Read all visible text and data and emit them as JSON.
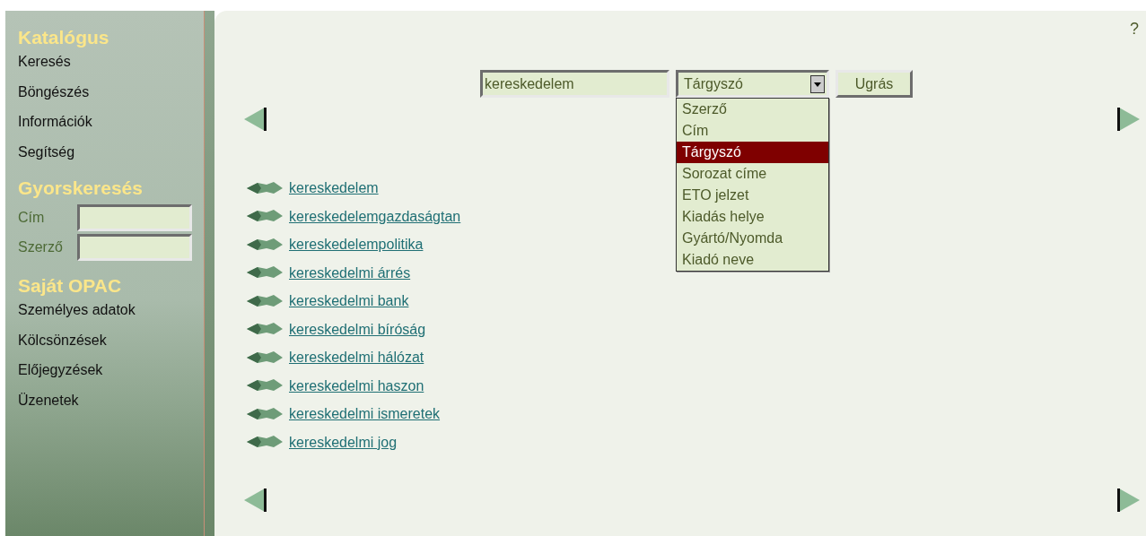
{
  "sidebar": {
    "sections": [
      {
        "kind": "links",
        "title": "Katalógus",
        "items": [
          "Keresés",
          "Böngészés",
          "Információk",
          "Segítség"
        ]
      },
      {
        "kind": "fields",
        "title": "Gyorskeresés",
        "items": [
          "Cím",
          "Szerző"
        ]
      },
      {
        "kind": "links",
        "title": "Saját OPAC",
        "items": [
          "Személyes adatok",
          "Kölcsönzések",
          "Előjegyzések",
          "Üzenetek"
        ]
      }
    ]
  },
  "help": "?",
  "search": {
    "query": "kereskedelem",
    "field": {
      "value": "Tárgyszó",
      "expanded": true,
      "options": [
        {
          "label": "Szerző",
          "selected": false
        },
        {
          "label": "Cím",
          "selected": false
        },
        {
          "label": "Tárgyszó",
          "selected": true
        },
        {
          "label": "Sorozat címe",
          "selected": false
        },
        {
          "label": "ETO jelzet",
          "selected": false
        },
        {
          "label": "Kiadás helye",
          "selected": false
        },
        {
          "label": "Gyártó/Nyomda",
          "selected": false
        },
        {
          "label": "Kiadó neve",
          "selected": false
        }
      ]
    },
    "button": "Ugrás"
  },
  "results": [
    "kereskedelem",
    "kereskedelemgazdaságtan",
    "kereskedelempolitika",
    "kereskedelmi árrés",
    "kereskedelmi bank",
    "kereskedelmi bíróság",
    "kereskedelmi hálózat",
    "kereskedelmi haszon",
    "kereskedelmi ismeretek",
    "kereskedelmi jog"
  ]
}
